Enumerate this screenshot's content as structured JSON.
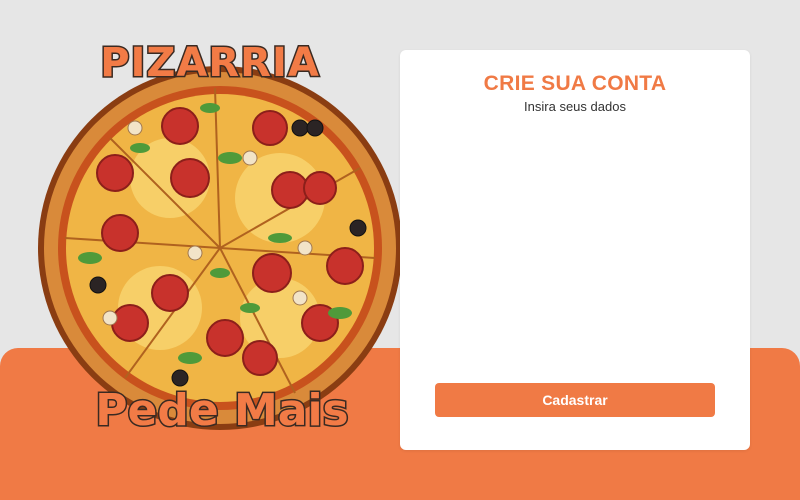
{
  "brand": {
    "name_top": "PIZARRIA",
    "name_bottom": "Pede Mais"
  },
  "signup_card": {
    "title": "CRIE SUA CONTA",
    "subtitle": "Insira seus dados",
    "submit_label": "Cadastrar"
  },
  "colors": {
    "accent": "#f07a45",
    "background": "#e6e6e6",
    "card": "#ffffff"
  }
}
